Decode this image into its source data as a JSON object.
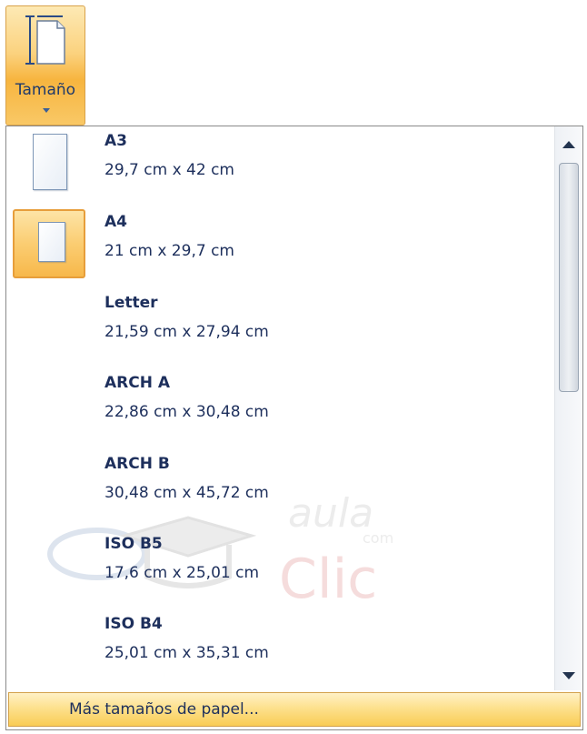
{
  "ribbon": {
    "size_button_label": "Tamaño",
    "icon": "page-size-icon"
  },
  "paper_sizes": [
    {
      "name": "A3",
      "dimensions": "29,7 cm x 42 cm",
      "selected": false
    },
    {
      "name": "A4",
      "dimensions": "21 cm x 29,7 cm",
      "selected": true
    },
    {
      "name": "Letter",
      "dimensions": "21,59 cm x 27,94 cm",
      "selected": false
    },
    {
      "name": "ARCH A",
      "dimensions": "22,86 cm x 30,48 cm",
      "selected": false
    },
    {
      "name": "ARCH B",
      "dimensions": "30,48 cm x 45,72 cm",
      "selected": false
    },
    {
      "name": "ISO B5",
      "dimensions": "17,6 cm x 25,01 cm",
      "selected": false
    },
    {
      "name": "ISO B4",
      "dimensions": "25,01 cm x 35,31 cm",
      "selected": false
    }
  ],
  "footer": {
    "more_sizes_label": "Más tamaños de papel..."
  },
  "watermark": {
    "text_top": "aula",
    "text_small": "com",
    "text_bottom": "Clic"
  },
  "colors": {
    "accent_orange": "#f7b53f",
    "text_navy": "#1d2f5c"
  }
}
